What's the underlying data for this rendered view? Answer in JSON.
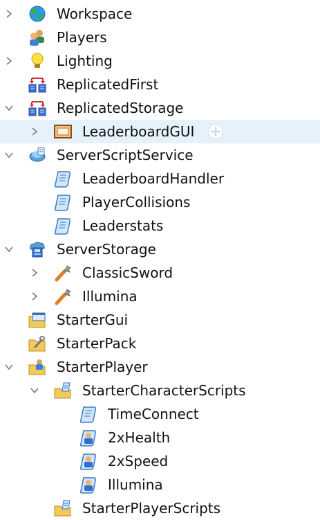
{
  "explorer": {
    "rows": [
      {
        "label": "Workspace",
        "icon": "globe-icon",
        "expander": "collapsed"
      },
      {
        "label": "Players",
        "icon": "players-icon",
        "expander": "none"
      },
      {
        "label": "Lighting",
        "icon": "lightbulb-icon",
        "expander": "collapsed"
      },
      {
        "label": "ReplicatedFirst",
        "icon": "replicated-icon",
        "expander": "none"
      },
      {
        "label": "ReplicatedStorage",
        "icon": "replicated-icon",
        "expander": "expanded"
      },
      {
        "label": "LeaderboardGUI",
        "icon": "screengui-icon",
        "expander": "collapsed",
        "selected": true,
        "add_button": true
      },
      {
        "label": "ServerScriptService",
        "icon": "server-script-service-icon",
        "expander": "expanded"
      },
      {
        "label": "LeaderboardHandler",
        "icon": "script-icon",
        "expander": "none"
      },
      {
        "label": "PlayerCollisions",
        "icon": "script-icon",
        "expander": "none"
      },
      {
        "label": "Leaderstats",
        "icon": "script-icon",
        "expander": "none"
      },
      {
        "label": "ServerStorage",
        "icon": "server-storage-icon",
        "expander": "expanded"
      },
      {
        "label": "ClassicSword",
        "icon": "tool-icon",
        "expander": "collapsed"
      },
      {
        "label": "Illumina",
        "icon": "tool-icon",
        "expander": "collapsed"
      },
      {
        "label": "StarterGui",
        "icon": "folder-gui-icon",
        "expander": "none"
      },
      {
        "label": "StarterPack",
        "icon": "folder-pack-icon",
        "expander": "none"
      },
      {
        "label": "StarterPlayer",
        "icon": "folder-player-icon",
        "expander": "expanded"
      },
      {
        "label": "StarterCharacterScripts",
        "icon": "folder-scripts-icon",
        "expander": "expanded"
      },
      {
        "label": "TimeConnect",
        "icon": "script-icon",
        "expander": "none"
      },
      {
        "label": "2xHealth",
        "icon": "local-script-icon",
        "expander": "none"
      },
      {
        "label": "2xSpeed",
        "icon": "local-script-icon",
        "expander": "none"
      },
      {
        "label": "Illumina",
        "icon": "local-script-icon",
        "expander": "none"
      },
      {
        "label": "StarterPlayerScripts",
        "icon": "folder-scripts-icon",
        "expander": "none"
      }
    ]
  },
  "colors": {
    "selection_bg": "#e5f1fb",
    "text": "#111111",
    "chevron": "#7a7a7a"
  }
}
